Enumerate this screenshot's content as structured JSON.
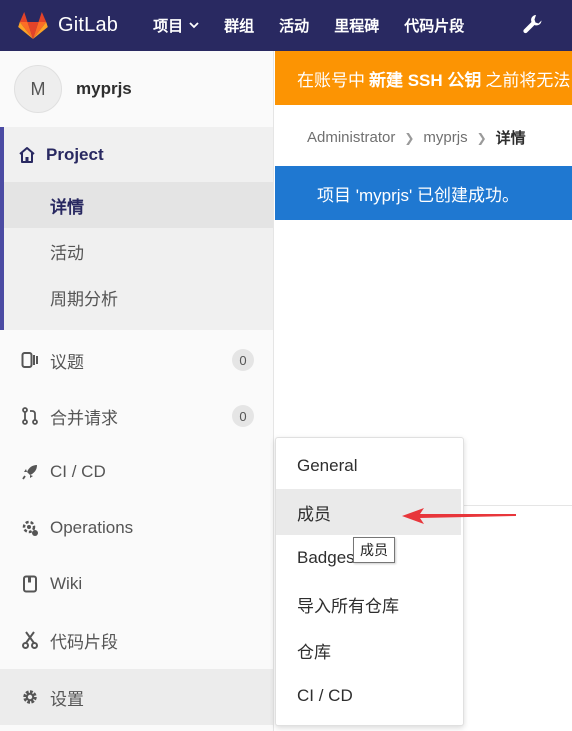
{
  "navbar": {
    "brand": "GitLab",
    "links": [
      {
        "label": "项目",
        "dropdown": true
      },
      {
        "label": "群组"
      },
      {
        "label": "活动"
      },
      {
        "label": "里程碑"
      },
      {
        "label": "代码片段"
      }
    ],
    "right_icon": "wrench-icon"
  },
  "sidebar": {
    "avatar_letter": "M",
    "project_name": "myprjs",
    "section": {
      "title": "Project",
      "icon": "home-icon",
      "items": [
        {
          "label": "详情",
          "active": true
        },
        {
          "label": "活动"
        },
        {
          "label": "周期分析"
        }
      ]
    },
    "items": [
      {
        "label": "议题",
        "icon": "issues-icon",
        "count": "0"
      },
      {
        "label": "合并请求",
        "icon": "merge-request-icon",
        "count": "0"
      },
      {
        "label": "CI / CD",
        "icon": "rocket-icon"
      },
      {
        "label": "Operations",
        "icon": "operations-icon"
      },
      {
        "label": "Wiki",
        "icon": "book-icon"
      },
      {
        "label": "代码片段",
        "icon": "snippet-icon"
      },
      {
        "label": "设置",
        "icon": "gear-icon",
        "active": true
      }
    ]
  },
  "banners": {
    "warning_prefix": "在账号中",
    "warning_bold": "新建 SSH 公钥",
    "warning_suffix": "之前将无法",
    "success": "项目 'myprjs' 已创建成功。"
  },
  "breadcrumb": [
    "Administrator",
    "myprjs",
    "详情"
  ],
  "flyout": {
    "items": [
      "General",
      "成员",
      "Badges",
      "导入所有仓库",
      "仓库",
      "CI / CD"
    ],
    "hovered_index": 1
  },
  "tooltip": "成员",
  "colors": {
    "navbar": "#292961",
    "warning": "#fc9403",
    "success": "#1f78d1",
    "active_border": "#4b4ba3",
    "arrow": "#e8363b"
  }
}
